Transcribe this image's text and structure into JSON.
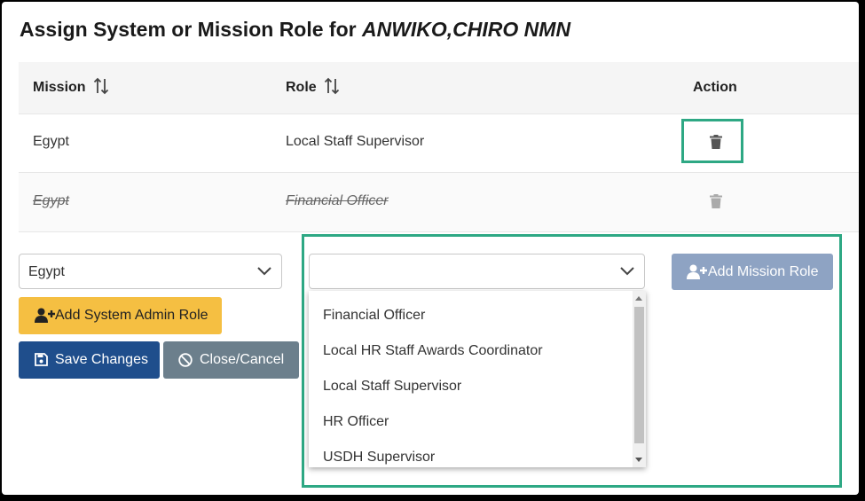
{
  "dialog": {
    "title_prefix": "Assign System or Mission Role for ",
    "title_name": "ANWIKO,CHIRO NMN"
  },
  "table": {
    "headers": {
      "mission": "Mission",
      "role": "Role",
      "action": "Action"
    },
    "rows": [
      {
        "mission": "Egypt",
        "role": "Local Staff Supervisor",
        "deleted": false
      },
      {
        "mission": "Egypt",
        "role": "Financial Officer",
        "deleted": true
      }
    ]
  },
  "form": {
    "mission_select": {
      "value": "Egypt"
    },
    "role_select": {
      "value": ""
    },
    "add_mission_role_label": "Add Mission Role",
    "add_system_admin_role_label": "Add System Admin Role",
    "save_label": "Save Changes",
    "cancel_label": "Close/Cancel",
    "role_options": [
      "Financial Officer",
      "Local HR Staff Awards Coordinator",
      "Local Staff Supervisor",
      "HR Officer",
      "USDH Supervisor"
    ]
  },
  "colors": {
    "highlight": "#2ea884",
    "add_system_admin_button": "#f5bf42",
    "save_button": "#1f4e8c",
    "cancel_button": "#6c7f8c",
    "add_mission_role_button": "#8ea3c3"
  },
  "icons": {
    "sort": "sort-arrows-icon",
    "delete": "trash-icon",
    "add_user": "user-plus-icon",
    "save": "floppy-disk-icon",
    "cancel": "ban-icon",
    "dropdown": "chevron-down-icon"
  }
}
